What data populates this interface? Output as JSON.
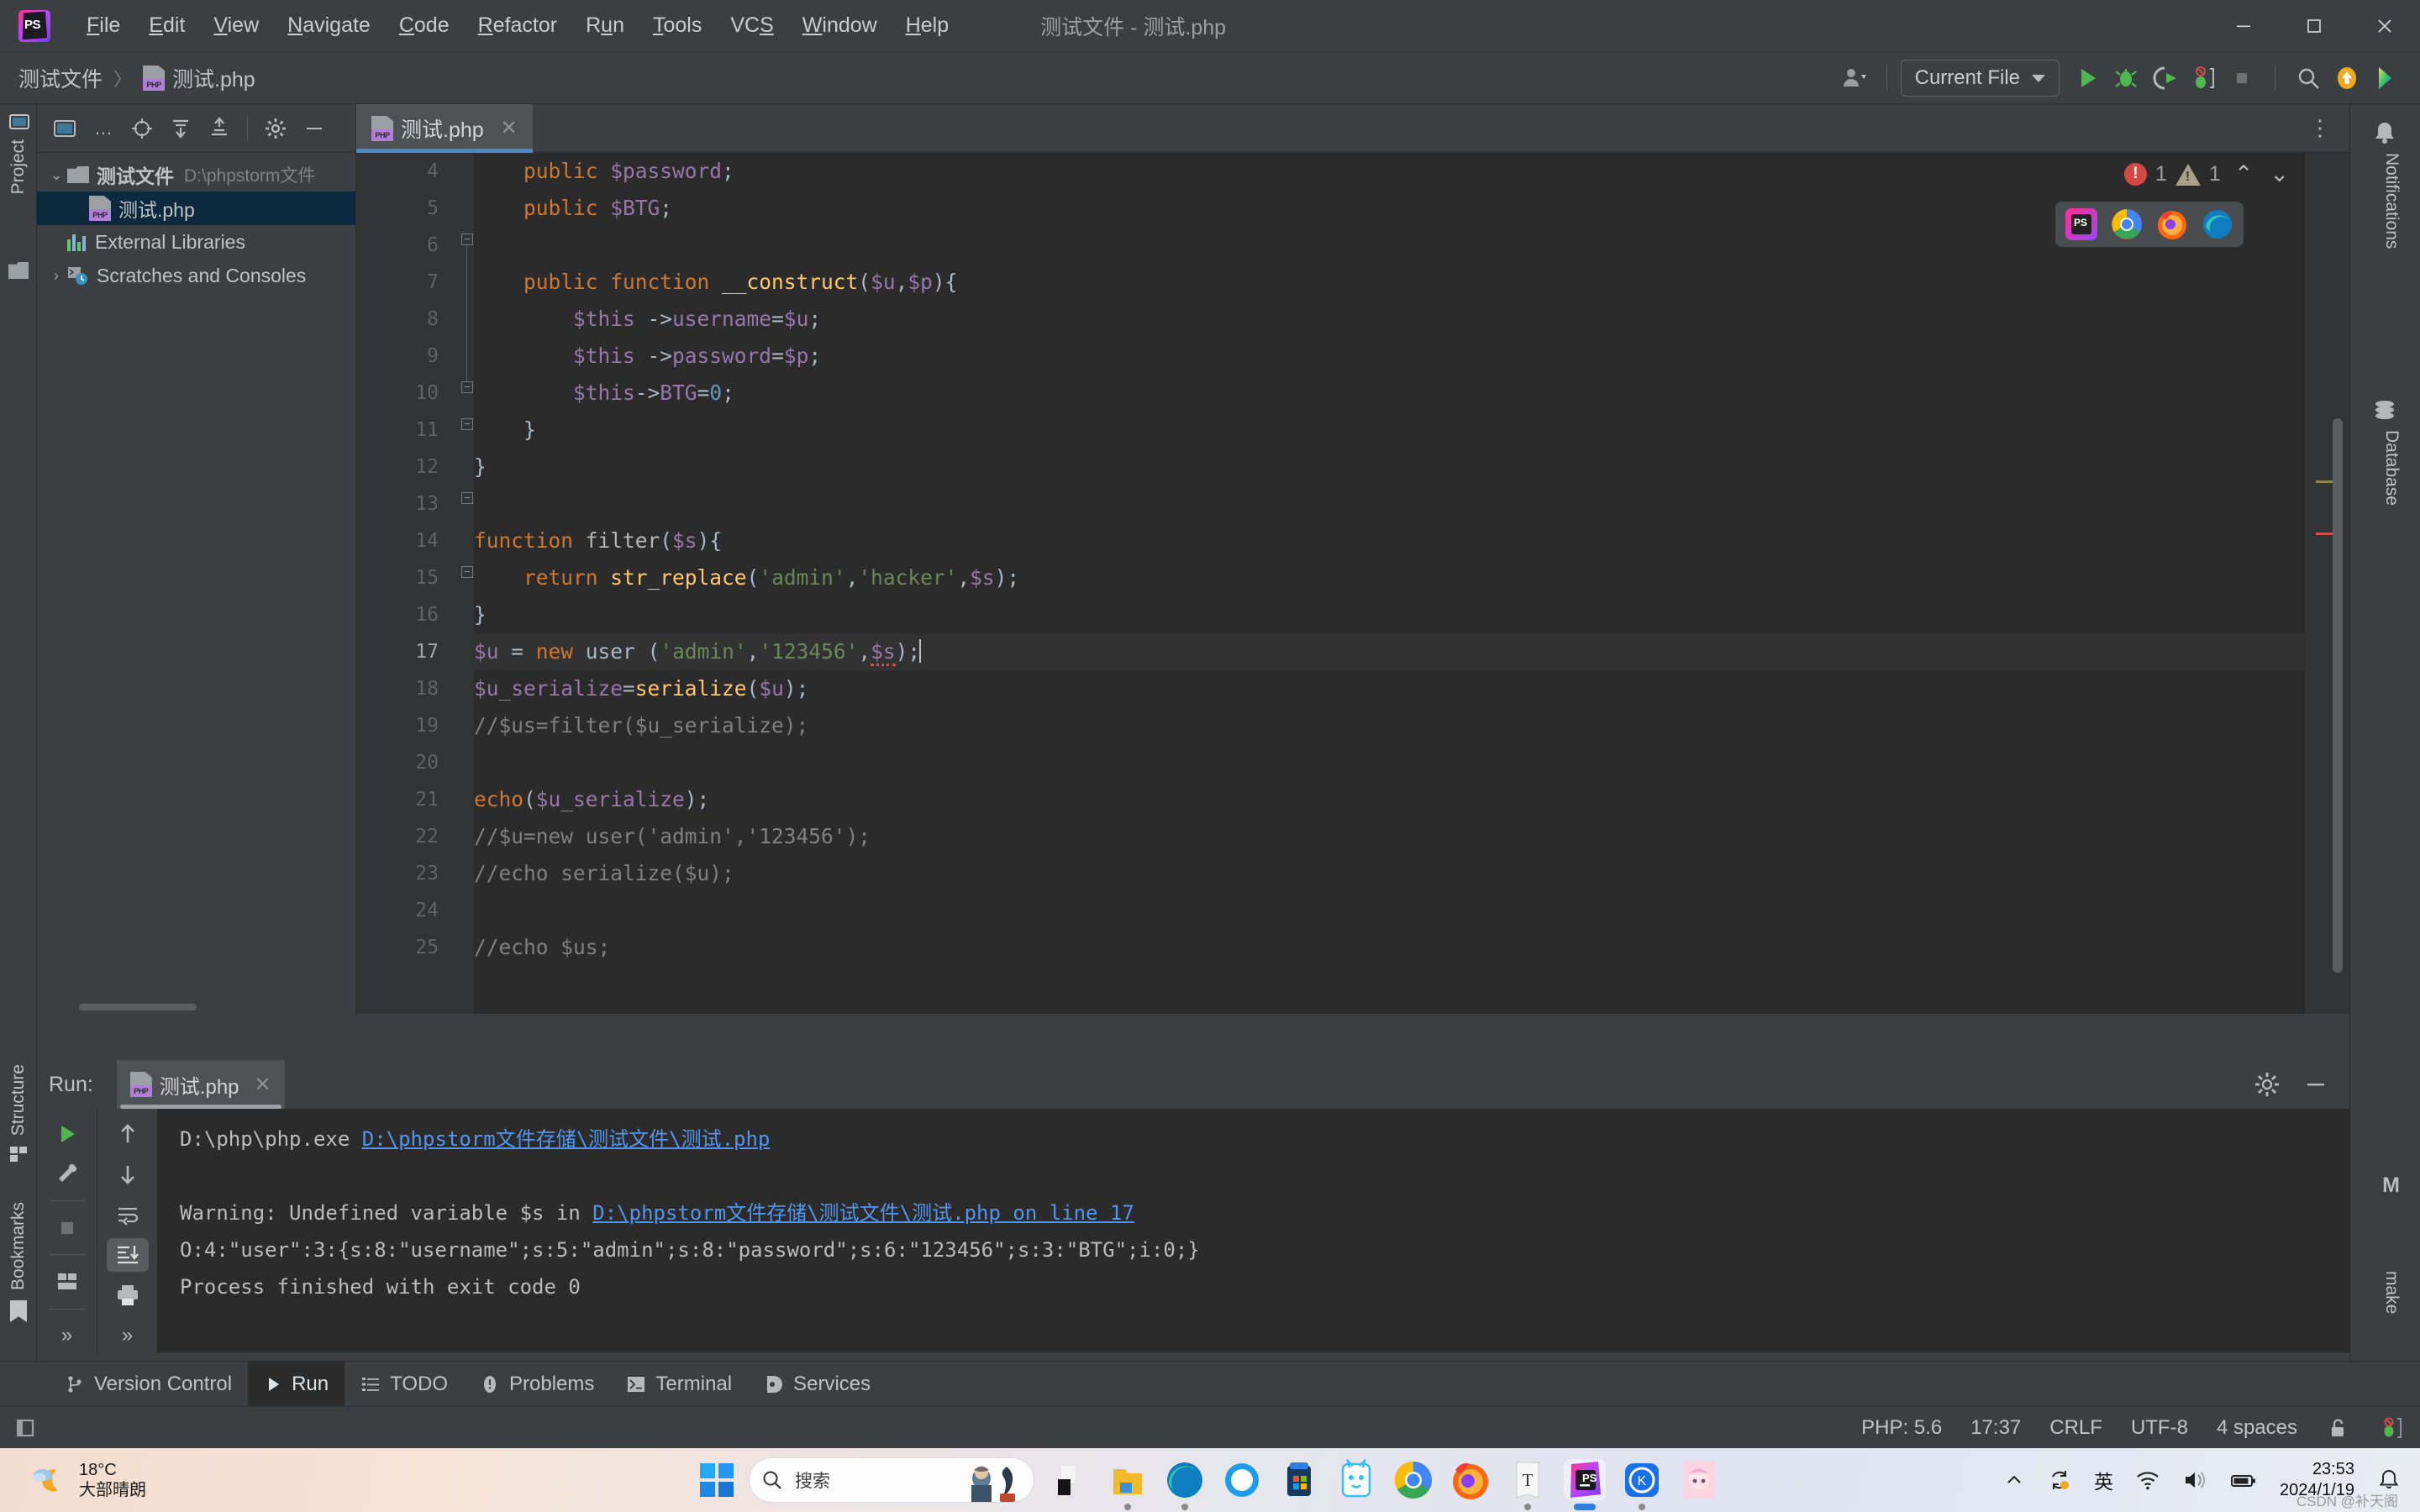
{
  "titlebar": {
    "app_icon": "phpstorm-logo",
    "menus": [
      {
        "label": "File",
        "mnemonic": "F"
      },
      {
        "label": "Edit",
        "mnemonic": "E"
      },
      {
        "label": "View",
        "mnemonic": "V"
      },
      {
        "label": "Navigate",
        "mnemonic": "N"
      },
      {
        "label": "Code",
        "mnemonic": "C"
      },
      {
        "label": "Refactor",
        "mnemonic": "R"
      },
      {
        "label": "Run",
        "mnemonic": "u"
      },
      {
        "label": "Tools",
        "mnemonic": "T"
      },
      {
        "label": "VCS",
        "mnemonic": "S"
      },
      {
        "label": "Window",
        "mnemonic": "W"
      },
      {
        "label": "Help",
        "mnemonic": "H"
      }
    ],
    "window_title": "测试文件 - 测试.php",
    "minimize": "—",
    "maximize": "▢",
    "close": "✕"
  },
  "navbar": {
    "breadcrumb": {
      "project": "测试文件",
      "separator": "〉",
      "file": "测试.php"
    },
    "run_config": {
      "label": "Current File",
      "dropdown_icon": "chevron-down-icon"
    },
    "icons": [
      "account-icon",
      "run-icon",
      "debug-icon",
      "run-with-coverage-icon",
      "profile-icon",
      "stop-icon",
      "search-everywhere-icon",
      "updates-icon",
      "ide-help-icon"
    ]
  },
  "left_stripe": {
    "project_tab": "Project",
    "structure_tab": "Structure",
    "bookmarks_tab": "Bookmarks"
  },
  "right_stripe": {
    "notifications_tab": "Notifications",
    "database_tab": "Database",
    "make_tab": "make",
    "make_badge": "M"
  },
  "project_panel": {
    "toolbar_icons": [
      "select-opened-file-icon",
      "locate-icon",
      "expand-all-icon",
      "collapse-all-icon",
      "settings-icon",
      "hide-icon"
    ],
    "tree": [
      {
        "label": "测试文件",
        "path": "D:\\phpstorm文件",
        "type": "folder",
        "expanded": true,
        "depth": 0,
        "selected": false
      },
      {
        "label": "测试.php",
        "path": "",
        "type": "php",
        "expanded": false,
        "depth": 1,
        "selected": true
      },
      {
        "label": "External Libraries",
        "path": "",
        "type": "library",
        "expanded": false,
        "depth": 0,
        "selected": false
      },
      {
        "label": "Scratches and Consoles",
        "path": "",
        "type": "scratch",
        "expanded": false,
        "depth": 0,
        "selected": false
      }
    ]
  },
  "editor": {
    "tab": {
      "label": "测试.php",
      "close_icon": "close-icon",
      "icon": "php-file-icon"
    },
    "more_icon": "more-options-icon",
    "inspections": {
      "error_icon": "error-icon",
      "error_count": "1",
      "warning_icon": "warning-icon",
      "warning_count": "1",
      "prev_icon": "chevron-up-icon",
      "next_icon": "chevron-down-icon"
    },
    "browsers": [
      "phpstorm-browser-icon",
      "chrome-icon",
      "firefox-icon",
      "edge-icon"
    ],
    "first_line": 4,
    "current_line": 17,
    "lines": [
      {
        "n": 4,
        "indent": 2,
        "tokens": [
          {
            "t": "public ",
            "c": "kw"
          },
          {
            "t": "$password",
            "c": "var"
          },
          {
            "t": ";",
            "c": "pl"
          }
        ]
      },
      {
        "n": 5,
        "indent": 2,
        "tokens": [
          {
            "t": "public ",
            "c": "kw"
          },
          {
            "t": "$BTG",
            "c": "var"
          },
          {
            "t": ";",
            "c": "pl"
          }
        ]
      },
      {
        "n": 6,
        "indent": 0,
        "tokens": []
      },
      {
        "n": 7,
        "indent": 2,
        "tokens": [
          {
            "t": "public function ",
            "c": "kw"
          },
          {
            "t": "__construct",
            "c": "fn"
          },
          {
            "t": "(",
            "c": "pl"
          },
          {
            "t": "$u",
            "c": "var"
          },
          {
            "t": ",",
            "c": "pl"
          },
          {
            "t": "$p",
            "c": "var"
          },
          {
            "t": "){",
            "c": "pl"
          }
        ]
      },
      {
        "n": 8,
        "indent": 4,
        "tokens": [
          {
            "t": "$this",
            "c": "var"
          },
          {
            "t": " ->",
            "c": "pl"
          },
          {
            "t": "username",
            "c": "var"
          },
          {
            "t": "=",
            "c": "pl"
          },
          {
            "t": "$u",
            "c": "var"
          },
          {
            "t": ";",
            "c": "pl"
          }
        ]
      },
      {
        "n": 9,
        "indent": 4,
        "tokens": [
          {
            "t": "$this",
            "c": "var"
          },
          {
            "t": " ->",
            "c": "pl"
          },
          {
            "t": "password",
            "c": "var"
          },
          {
            "t": "=",
            "c": "pl"
          },
          {
            "t": "$p",
            "c": "var"
          },
          {
            "t": ";",
            "c": "pl"
          }
        ]
      },
      {
        "n": 10,
        "indent": 4,
        "tokens": [
          {
            "t": "$this",
            "c": "var"
          },
          {
            "t": "->",
            "c": "pl"
          },
          {
            "t": "BTG",
            "c": "var"
          },
          {
            "t": "=",
            "c": "pl"
          },
          {
            "t": "0",
            "c": "num"
          },
          {
            "t": ";",
            "c": "pl"
          }
        ]
      },
      {
        "n": 11,
        "indent": 2,
        "tokens": [
          {
            "t": "}",
            "c": "pl"
          }
        ]
      },
      {
        "n": 12,
        "indent": 0,
        "tokens": [
          {
            "t": "}",
            "c": "pl"
          }
        ]
      },
      {
        "n": 13,
        "indent": 0,
        "tokens": []
      },
      {
        "n": 14,
        "indent": 0,
        "tokens": [
          {
            "t": "function ",
            "c": "kw"
          },
          {
            "t": "filter",
            "c": "fname"
          },
          {
            "t": "(",
            "c": "pl"
          },
          {
            "t": "$s",
            "c": "var"
          },
          {
            "t": "){",
            "c": "pl"
          }
        ]
      },
      {
        "n": 15,
        "indent": 2,
        "tokens": [
          {
            "t": "return ",
            "c": "kw"
          },
          {
            "t": "str_replace",
            "c": "fn"
          },
          {
            "t": "(",
            "c": "pl"
          },
          {
            "t": "'admin'",
            "c": "str"
          },
          {
            "t": ",",
            "c": "pl"
          },
          {
            "t": "'hacker'",
            "c": "str"
          },
          {
            "t": ",",
            "c": "pl"
          },
          {
            "t": "$s",
            "c": "var"
          },
          {
            "t": ");",
            "c": "pl"
          }
        ]
      },
      {
        "n": 16,
        "indent": 0,
        "tokens": [
          {
            "t": "}",
            "c": "pl"
          }
        ]
      },
      {
        "n": 17,
        "indent": 0,
        "tokens": [
          {
            "t": "$u",
            "c": "var"
          },
          {
            "t": " = ",
            "c": "pl"
          },
          {
            "t": "new ",
            "c": "kw"
          },
          {
            "t": "user",
            "c": "pl"
          },
          {
            "t": " (",
            "c": "pl"
          },
          {
            "t": "'admin'",
            "c": "str"
          },
          {
            "t": ",",
            "c": "pl"
          },
          {
            "t": "'123456'",
            "c": "str"
          },
          {
            "t": ",",
            "c": "pl"
          },
          {
            "t": "$s",
            "c": "var squig"
          },
          {
            "t": ");",
            "c": "pl"
          }
        ]
      },
      {
        "n": 18,
        "indent": 0,
        "tokens": [
          {
            "t": "$u_serialize",
            "c": "var"
          },
          {
            "t": "=",
            "c": "pl"
          },
          {
            "t": "serialize",
            "c": "fn"
          },
          {
            "t": "(",
            "c": "pl"
          },
          {
            "t": "$u",
            "c": "var"
          },
          {
            "t": ");",
            "c": "pl"
          }
        ]
      },
      {
        "n": 19,
        "indent": 0,
        "tokens": [
          {
            "t": "//$us=filter($u_serialize);",
            "c": "cmt"
          }
        ]
      },
      {
        "n": 20,
        "indent": 0,
        "tokens": []
      },
      {
        "n": 21,
        "indent": 0,
        "tokens": [
          {
            "t": "echo",
            "c": "kw"
          },
          {
            "t": "(",
            "c": "pl"
          },
          {
            "t": "$u_serialize",
            "c": "var"
          },
          {
            "t": ");",
            "c": "pl"
          }
        ]
      },
      {
        "n": 22,
        "indent": 0,
        "tokens": [
          {
            "t": "//$u=new user('admin','123456');",
            "c": "cmt"
          }
        ]
      },
      {
        "n": 23,
        "indent": 0,
        "tokens": [
          {
            "t": "//echo serialize($u);",
            "c": "cmt"
          }
        ]
      },
      {
        "n": 24,
        "indent": 0,
        "tokens": []
      },
      {
        "n": 25,
        "indent": 0,
        "tokens": [
          {
            "t": "//echo $us;",
            "c": "cmt"
          }
        ]
      }
    ]
  },
  "run_panel": {
    "label": "Run:",
    "tab": {
      "label": "测试.php",
      "close_icon": "close-icon"
    },
    "settings_icon": "settings-icon",
    "hide_icon": "hide-icon",
    "tools_left": [
      "rerun-icon",
      "edit-configuration-icon",
      "stop-icon",
      "layout-icon",
      "more-icon"
    ],
    "tools_right": [
      "up-icon",
      "down-icon",
      "soft-wrap-icon",
      "scroll-to-end-icon",
      "print-icon",
      "more-icon"
    ],
    "console": [
      {
        "parts": [
          {
            "t": "D:\\php\\php.exe ",
            "c": "plain"
          },
          {
            "t": "D:\\phpstorm文件存储\\测试文件\\测试.php",
            "c": "link"
          }
        ]
      },
      {
        "parts": []
      },
      {
        "parts": [
          {
            "t": "Warning: Undefined variable $s in ",
            "c": "plain"
          },
          {
            "t": "D:\\phpstorm文件存储\\测试文件\\测试.php on line 17",
            "c": "link"
          }
        ]
      },
      {
        "parts": [
          {
            "t": "O:4:\"user\":3:{s:8:\"username\";s:5:\"admin\";s:8:\"password\";s:6:\"123456\";s:3:\"BTG\";i:0;}",
            "c": "plain"
          }
        ]
      },
      {
        "parts": [
          {
            "t": "Process finished with exit code 0",
            "c": "plain"
          }
        ]
      }
    ]
  },
  "tool_window_bar": [
    {
      "label": "Version Control",
      "icon": "branch-icon",
      "active": false
    },
    {
      "label": "Run",
      "icon": "run-icon",
      "active": true
    },
    {
      "label": "TODO",
      "icon": "todo-list-icon",
      "active": false
    },
    {
      "label": "Problems",
      "icon": "problems-icon",
      "active": false
    },
    {
      "label": "Terminal",
      "icon": "terminal-icon",
      "active": false
    },
    {
      "label": "Services",
      "icon": "services-icon",
      "active": false
    }
  ],
  "status_bar": {
    "items": [
      "PHP: 5.6",
      "17:37",
      "CRLF",
      "UTF-8",
      "4 spaces"
    ],
    "lock_icon": "unlocked-icon",
    "debug_icon": "debug-inactive-icon"
  },
  "taskbar": {
    "weather": {
      "temp": "18°C",
      "desc": "大部晴朗",
      "icon": "partly-cloudy-night-icon"
    },
    "start_icon": "windows-start-icon",
    "search_placeholder": "搜索",
    "search_icon": "search-icon",
    "apps": [
      {
        "name": "file-explorer-dark-icon",
        "running": false
      },
      {
        "name": "file-explorer-icon",
        "running": true
      },
      {
        "name": "edge-icon",
        "running": true
      },
      {
        "name": "browser-icon",
        "running": false
      },
      {
        "name": "microsoft-store-icon",
        "running": false
      },
      {
        "name": "rabbit-app-icon",
        "running": false
      },
      {
        "name": "chrome-icon",
        "running": false
      },
      {
        "name": "firefox-icon",
        "running": false
      },
      {
        "name": "text-editor-icon",
        "running": true
      },
      {
        "name": "phpstorm-icon",
        "running": true,
        "active": true
      },
      {
        "name": "kuwo-icon",
        "running": true
      },
      {
        "name": "anime-app-icon",
        "running": false
      }
    ],
    "tray": {
      "overflow_icon": "chevron-up-icon",
      "sync_icon": "sync-icon",
      "ime_label": "英",
      "wifi_icon": "wifi-icon",
      "volume_icon": "volume-icon",
      "battery_icon": "battery-icon",
      "time": "23:53",
      "date": "2024/1/19",
      "notification_icon": "bell-icon"
    },
    "watermark": "CSDN @补天阁"
  }
}
